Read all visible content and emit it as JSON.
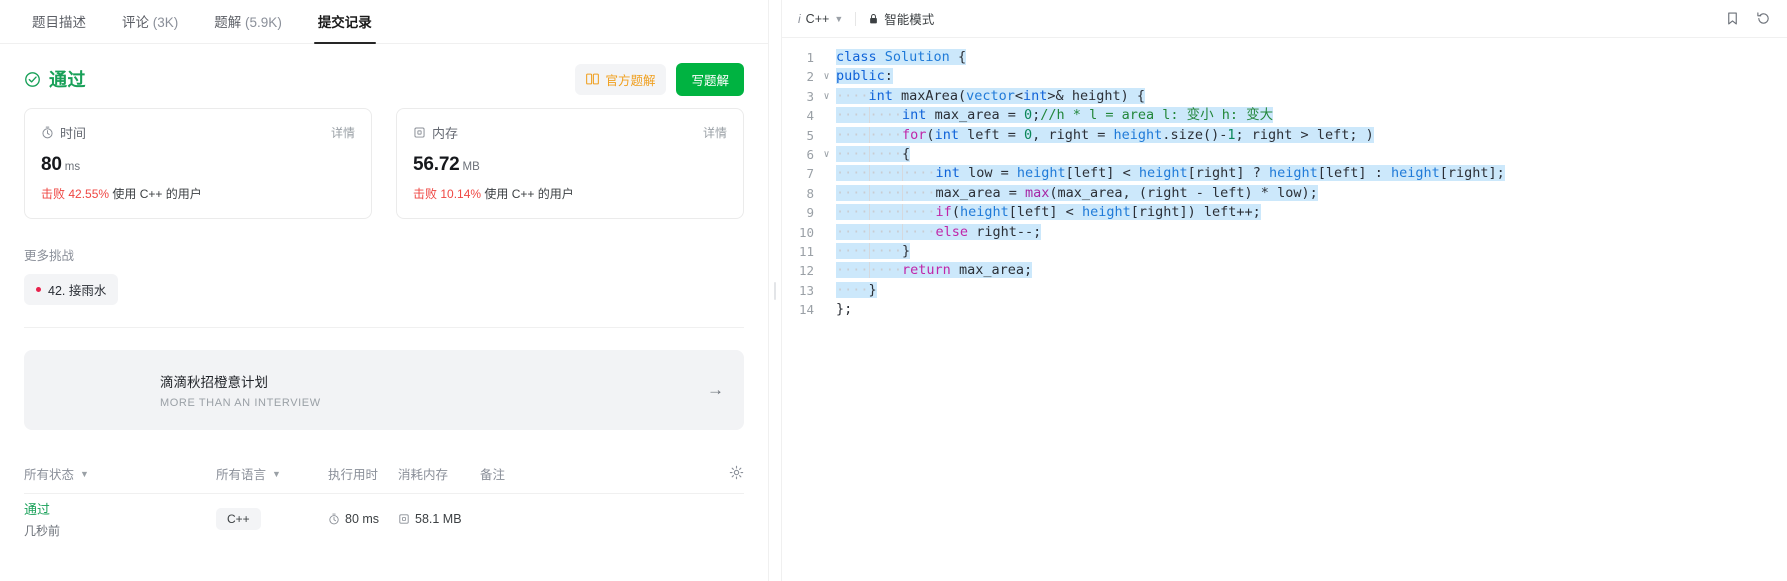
{
  "tabs": [
    {
      "label": "题目描述",
      "count": "",
      "active": false
    },
    {
      "label": "评论",
      "count": "(3K)",
      "active": false
    },
    {
      "label": "题解",
      "count": "(5.9K)",
      "active": false
    },
    {
      "label": "提交记录",
      "count": "",
      "active": true
    }
  ],
  "result": {
    "status": "通过",
    "status_color": "#18a058",
    "official_solution_label": "官方题解",
    "write_solution_label": "写题解"
  },
  "cards": [
    {
      "title": "时间",
      "icon": "stopwatch-icon",
      "detail_label": "详情",
      "value": "80",
      "unit": "ms",
      "beat_prefix": "击败",
      "beat_pct": "42.55%",
      "beat_suffix": "使用 C++ 的用户"
    },
    {
      "title": "内存",
      "icon": "memory-icon",
      "detail_label": "详情",
      "value": "56.72",
      "unit": "MB",
      "beat_prefix": "击败",
      "beat_pct": "10.14%",
      "beat_suffix": "使用 C++ 的用户"
    }
  ],
  "more_challenges": {
    "title": "更多挑战",
    "chips": [
      {
        "label": "42. 接雨水",
        "dot_color": "#e8214b"
      }
    ]
  },
  "promo": {
    "title": "滴滴秋招橙意计划",
    "subtitle": "MORE THAN AN INTERVIEW",
    "arrow": "→"
  },
  "submissions_table": {
    "headers": {
      "status": "所有状态",
      "language": "所有语言",
      "runtime": "执行用时",
      "memory": "消耗内存",
      "note": "备注",
      "settings_icon": "gear-icon"
    },
    "rows": [
      {
        "status": "通过",
        "time_ago": "几秒前",
        "language": "C++",
        "runtime": "80 ms",
        "memory": "58.1 MB",
        "note": ""
      }
    ]
  },
  "editor": {
    "language": "C++",
    "mode_label": "智能模式",
    "lock_icon": "lock-icon",
    "info_icon": "info-icon",
    "chevron_icon": "chevron-down-icon",
    "bookmark_icon": "bookmark-icon",
    "history_icon": "history-revert-icon",
    "lines": [
      {
        "n": "1",
        "fold": ""
      },
      {
        "n": "2",
        "fold": "∨"
      },
      {
        "n": "3",
        "fold": "∨"
      },
      {
        "n": "4",
        "fold": ""
      },
      {
        "n": "5",
        "fold": ""
      },
      {
        "n": "6",
        "fold": "∨"
      },
      {
        "n": "7",
        "fold": ""
      },
      {
        "n": "8",
        "fold": ""
      },
      {
        "n": "9",
        "fold": ""
      },
      {
        "n": "10",
        "fold": ""
      },
      {
        "n": "11",
        "fold": ""
      },
      {
        "n": "12",
        "fold": ""
      },
      {
        "n": "13",
        "fold": ""
      },
      {
        "n": "14",
        "fold": ""
      }
    ],
    "code_text": [
      "class Solution {",
      "public:",
      "    int maxArea(vector<int>& height) {",
      "        int max_area = 0;//h * l = area l: 变小 h: 变大",
      "        for(int left = 0, right = height.size()-1; right > left; )",
      "        {",
      "            int low = height[left] < height[right] ? height[left] : height[right];",
      "            max_area = max(max_area, (right - left) * low);",
      "            if(height[left] < height[right]) left++;",
      "            else right--;",
      "        }",
      "        return max_area;",
      "    }",
      "};"
    ]
  }
}
